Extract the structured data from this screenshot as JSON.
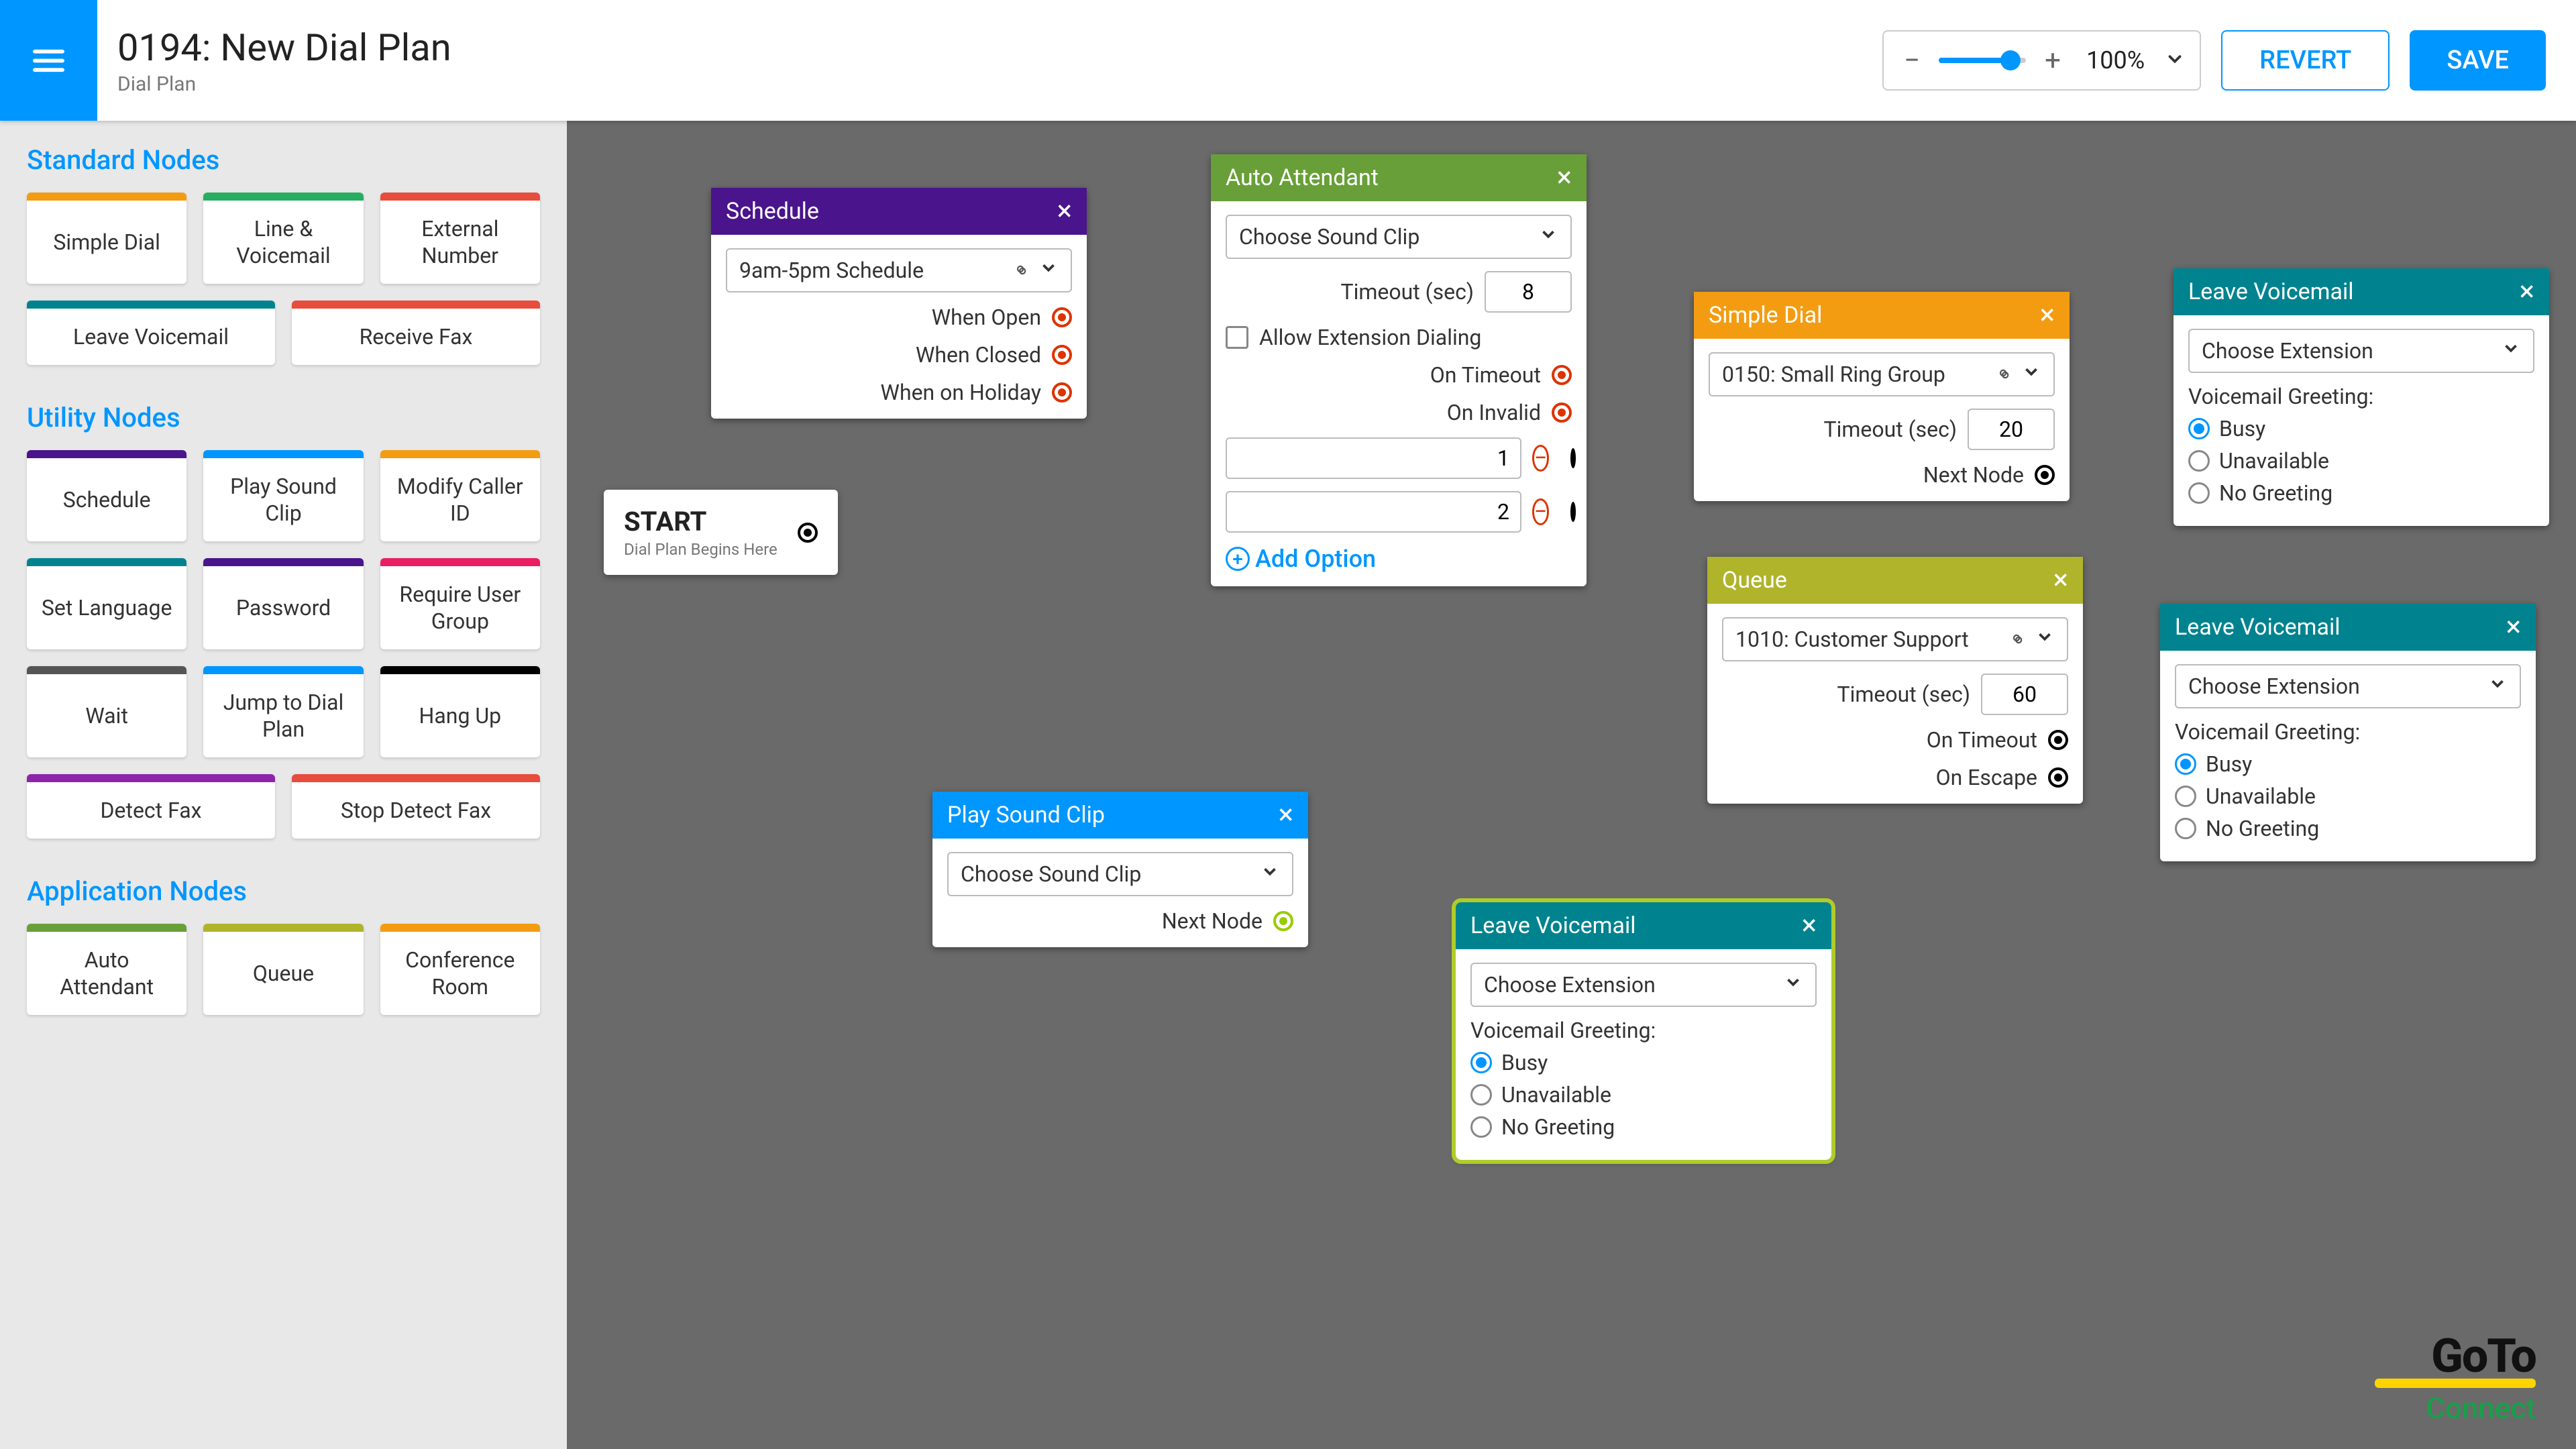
{
  "header": {
    "title": "0194: New Dial Plan",
    "subtitle": "Dial Plan",
    "zoom": "100%",
    "revert": "REVERT",
    "save": "SAVE"
  },
  "sidebar": {
    "standard_title": "Standard Nodes",
    "utility_title": "Utility Nodes",
    "application_title": "Application Nodes",
    "standard": [
      "Simple Dial",
      "Line & Voicemail",
      "External Number",
      "Leave Voicemail",
      "Receive Fax"
    ],
    "utility": [
      "Schedule",
      "Play Sound Clip",
      "Modify Caller ID",
      "Set Language",
      "Password",
      "Require User Group",
      "Wait",
      "Jump to Dial Plan",
      "Hang Up",
      "Detect Fax",
      "Stop Detect Fax"
    ],
    "application": [
      "Auto Attendant",
      "Queue",
      "Conference Room"
    ],
    "colors": {
      "standard": [
        "#f39c12",
        "#27ae60",
        "#e74c3c",
        "#00838f",
        "#e74c3c"
      ],
      "utility": [
        "#4a148c",
        "#0096ff",
        "#f39c12",
        "#00838f",
        "#4a148c",
        "#e91e63",
        "#555",
        "#0096ff",
        "#000",
        "#8e24aa",
        "#e74c3c"
      ],
      "application": [
        "#689f38",
        "#afb42b",
        "#f39c12"
      ]
    }
  },
  "nodes": {
    "start": {
      "title": "START",
      "sub": "Dial Plan Begins Here"
    },
    "schedule": {
      "title": "Schedule",
      "select": "9am-5pm Schedule",
      "outs": [
        "When Open",
        "When Closed",
        "When on Holiday"
      ]
    },
    "auto": {
      "title": "Auto Attendant",
      "select": "Choose Sound Clip",
      "timeout_label": "Timeout (sec)",
      "timeout": "8",
      "allow_ext": "Allow Extension Dialing",
      "on_timeout": "On Timeout",
      "on_invalid": "On Invalid",
      "options": [
        "1",
        "2"
      ],
      "add": "Add Option"
    },
    "play": {
      "title": "Play Sound Clip",
      "select": "Choose Sound Clip",
      "next": "Next Node"
    },
    "simple": {
      "title": "Simple Dial",
      "select": "0150: Small Ring Group",
      "timeout_label": "Timeout (sec)",
      "timeout": "20",
      "next": "Next Node"
    },
    "queue": {
      "title": "Queue",
      "select": "1010: Customer Support",
      "timeout_label": "Timeout (sec)",
      "timeout": "60",
      "on_timeout": "On Timeout",
      "on_escape": "On Escape"
    },
    "vm": {
      "title": "Leave Voicemail",
      "select": "Choose Extension",
      "greeting_label": "Voicemail Greeting:",
      "opts": [
        "Busy",
        "Unavailable",
        "No Greeting"
      ]
    }
  },
  "logo": {
    "brand": "GoTo",
    "product": "Connect"
  }
}
